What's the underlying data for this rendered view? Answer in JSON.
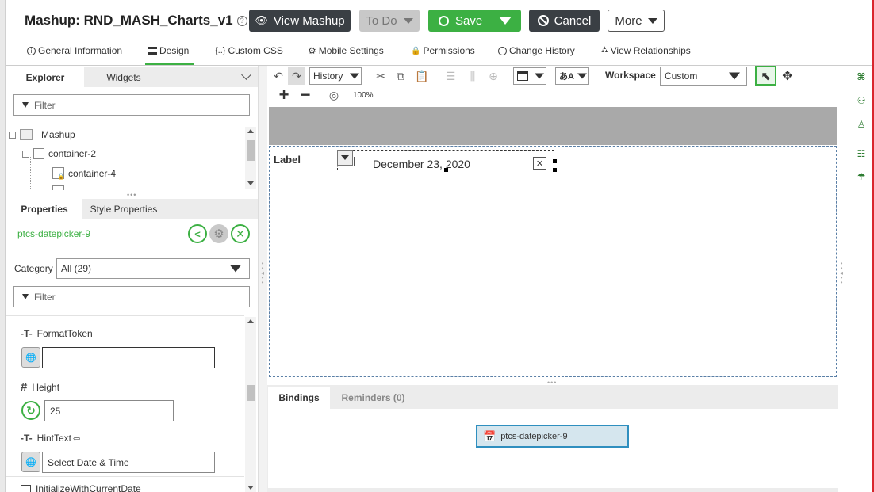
{
  "header": {
    "title": "Mashup: RND_MASH_Charts_v1",
    "view_mashup": "View Mashup",
    "todo": "To Do",
    "save": "Save",
    "cancel": "Cancel",
    "more": "More"
  },
  "tabs": [
    {
      "label": "General Information"
    },
    {
      "label": "Design"
    },
    {
      "label": "Custom CSS"
    },
    {
      "label": "Mobile Settings"
    },
    {
      "label": "Permissions"
    },
    {
      "label": "Change History"
    },
    {
      "label": "View Relationships"
    }
  ],
  "explorer": {
    "tab_explorer": "Explorer",
    "tab_widgets": "Widgets",
    "filter_placeholder": "Filter",
    "tree": [
      "Mashup",
      "container-2",
      "container-4"
    ]
  },
  "properties": {
    "tab_properties": "Properties",
    "tab_style": "Style Properties",
    "widget_name": "ptcs-datepicker-9",
    "category_label": "Category",
    "category_value": "All (29)",
    "filter_placeholder": "Filter",
    "items": [
      {
        "name": "FormatToken",
        "value": ""
      },
      {
        "name": "Height",
        "value": "25"
      },
      {
        "name": "HintText",
        "value": "Select Date & Time"
      },
      {
        "name": "InitializeWithCurrentDate"
      }
    ]
  },
  "toolbar": {
    "history": "History",
    "workspace_label": "Workspace",
    "workspace_value": "Custom",
    "zoom": "100%"
  },
  "canvas": {
    "label": "Label",
    "date_value": "December 23, 2020"
  },
  "bindings": {
    "tab_bindings": "Bindings",
    "tab_reminders": "Reminders (0)",
    "node_label": "ptcs-datepicker-9"
  },
  "colors": {
    "accent_green": "#3cb043",
    "dark_button": "#3a3f44",
    "canvas_header": "#a9a9a9"
  }
}
